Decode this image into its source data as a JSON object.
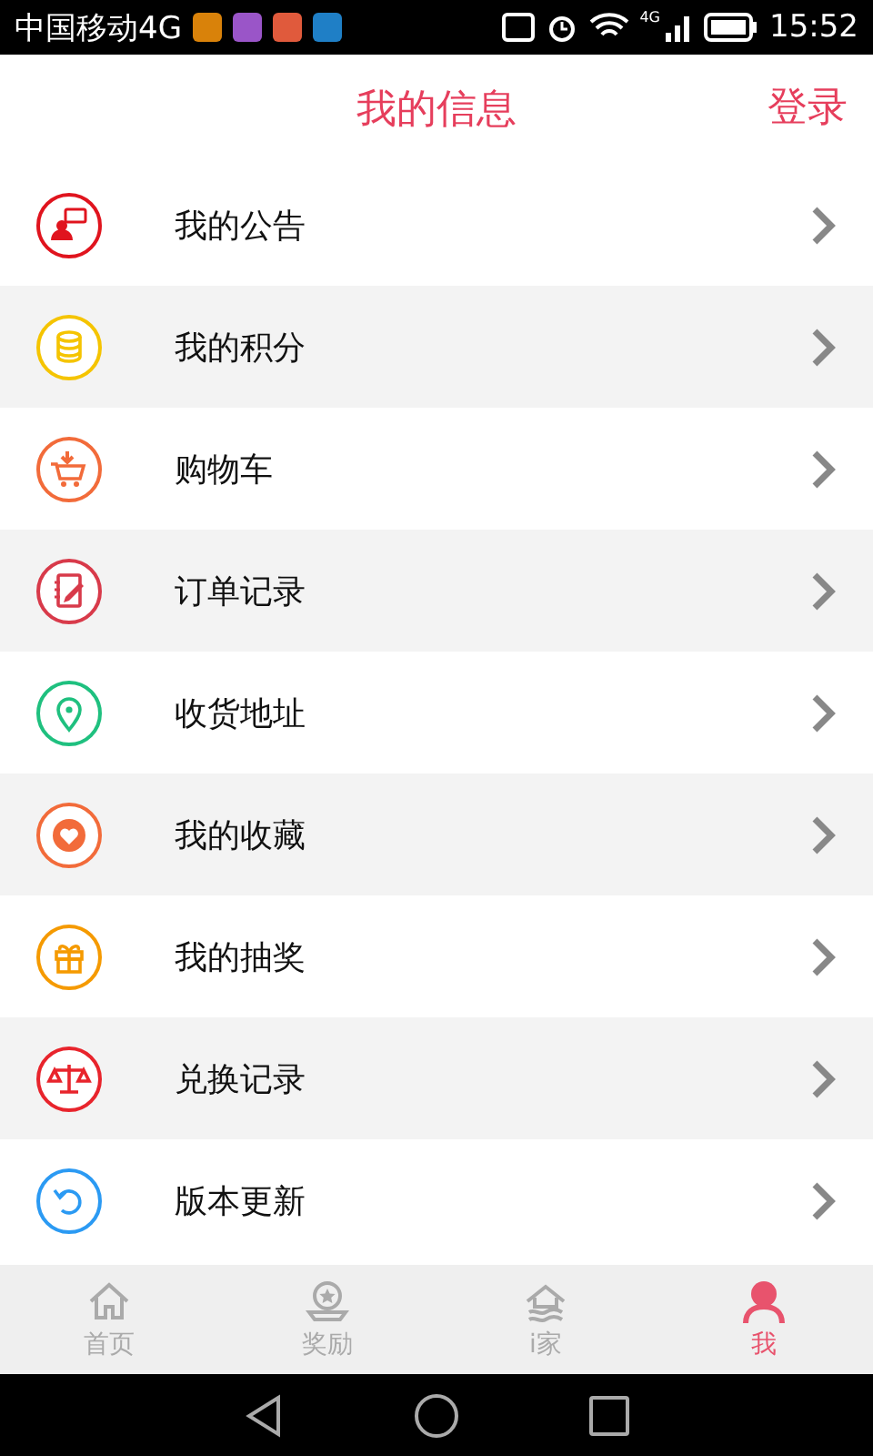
{
  "status_bar": {
    "carrier": "中国移动4G",
    "network": "4G",
    "time": "15:52"
  },
  "header": {
    "title": "我的信息",
    "action": "登录"
  },
  "menu": [
    {
      "label": "我的公告",
      "kind": "announcement",
      "color": "#e0141e"
    },
    {
      "label": "我的积分",
      "kind": "coins",
      "color": "#f5c400"
    },
    {
      "label": "购物车",
      "kind": "cart",
      "color": "#f26b3a"
    },
    {
      "label": "订单记录",
      "kind": "notebook",
      "color": "#d83a4a"
    },
    {
      "label": "收货地址",
      "kind": "location",
      "color": "#1fc07f"
    },
    {
      "label": "我的收藏",
      "kind": "heart",
      "color": "#f26b3a"
    },
    {
      "label": "我的抽奖",
      "kind": "gift",
      "color": "#f59a00"
    },
    {
      "label": "兑换记录",
      "kind": "scale",
      "color": "#e8242c"
    },
    {
      "label": "版本更新",
      "kind": "update",
      "color": "#2b9af3"
    }
  ],
  "tabs": [
    {
      "label": "首页",
      "kind": "home",
      "selected": false
    },
    {
      "label": "奖励",
      "kind": "medal",
      "selected": false
    },
    {
      "label": "i家",
      "kind": "house",
      "selected": false
    },
    {
      "label": "我",
      "kind": "person",
      "selected": true
    }
  ]
}
